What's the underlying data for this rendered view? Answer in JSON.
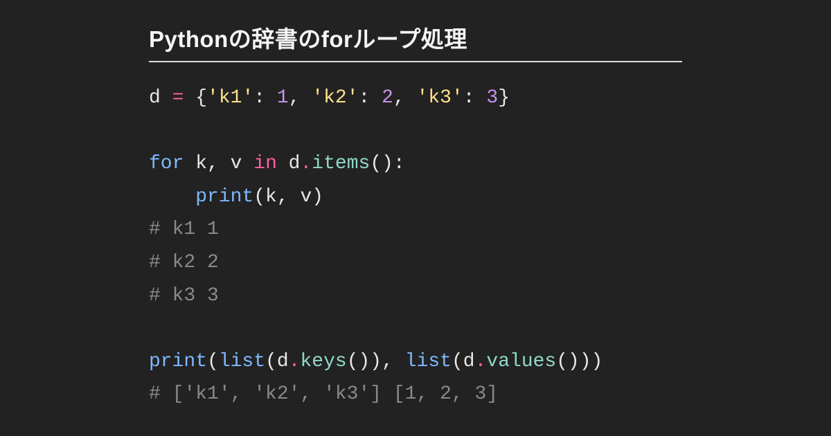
{
  "title": "Pythonの辞書のforループ処理",
  "code": {
    "tokens": [
      [
        {
          "t": "d ",
          "c": "name"
        },
        {
          "t": "=",
          "c": "op"
        },
        {
          "t": " ",
          "c": "name"
        },
        {
          "t": "{",
          "c": "punc"
        },
        {
          "t": "'k1'",
          "c": "str"
        },
        {
          "t": ": ",
          "c": "punc"
        },
        {
          "t": "1",
          "c": "num"
        },
        {
          "t": ", ",
          "c": "punc"
        },
        {
          "t": "'k2'",
          "c": "str"
        },
        {
          "t": ": ",
          "c": "punc"
        },
        {
          "t": "2",
          "c": "num"
        },
        {
          "t": ", ",
          "c": "punc"
        },
        {
          "t": "'k3'",
          "c": "str"
        },
        {
          "t": ": ",
          "c": "punc"
        },
        {
          "t": "3",
          "c": "num"
        },
        {
          "t": "}",
          "c": "punc"
        }
      ],
      [],
      [
        {
          "t": "for",
          "c": "kw"
        },
        {
          "t": " k",
          "c": "name"
        },
        {
          "t": ",",
          "c": "punc"
        },
        {
          "t": " v ",
          "c": "name"
        },
        {
          "t": "in",
          "c": "op"
        },
        {
          "t": " d",
          "c": "name"
        },
        {
          "t": ".",
          "c": "op"
        },
        {
          "t": "items",
          "c": "func"
        },
        {
          "t": "():",
          "c": "punc"
        }
      ],
      [
        {
          "t": "    ",
          "c": "name"
        },
        {
          "t": "print",
          "c": "kw"
        },
        {
          "t": "(",
          "c": "punc"
        },
        {
          "t": "k",
          "c": "name"
        },
        {
          "t": ",",
          "c": "punc"
        },
        {
          "t": " v",
          "c": "name"
        },
        {
          "t": ")",
          "c": "punc"
        }
      ],
      [
        {
          "t": "# k1 1",
          "c": "comm"
        }
      ],
      [
        {
          "t": "# k2 2",
          "c": "comm"
        }
      ],
      [
        {
          "t": "# k3 3",
          "c": "comm"
        }
      ],
      [],
      [
        {
          "t": "print",
          "c": "kw"
        },
        {
          "t": "(",
          "c": "punc"
        },
        {
          "t": "list",
          "c": "kw"
        },
        {
          "t": "(",
          "c": "punc"
        },
        {
          "t": "d",
          "c": "name"
        },
        {
          "t": ".",
          "c": "op"
        },
        {
          "t": "keys",
          "c": "func"
        },
        {
          "t": "())",
          "c": "punc"
        },
        {
          "t": ",",
          "c": "punc"
        },
        {
          "t": " ",
          "c": "name"
        },
        {
          "t": "list",
          "c": "kw"
        },
        {
          "t": "(",
          "c": "punc"
        },
        {
          "t": "d",
          "c": "name"
        },
        {
          "t": ".",
          "c": "op"
        },
        {
          "t": "values",
          "c": "func"
        },
        {
          "t": "()))",
          "c": "punc"
        }
      ],
      [
        {
          "t": "# ['k1', 'k2', 'k3'] [1, 2, 3]",
          "c": "comm"
        }
      ]
    ]
  }
}
